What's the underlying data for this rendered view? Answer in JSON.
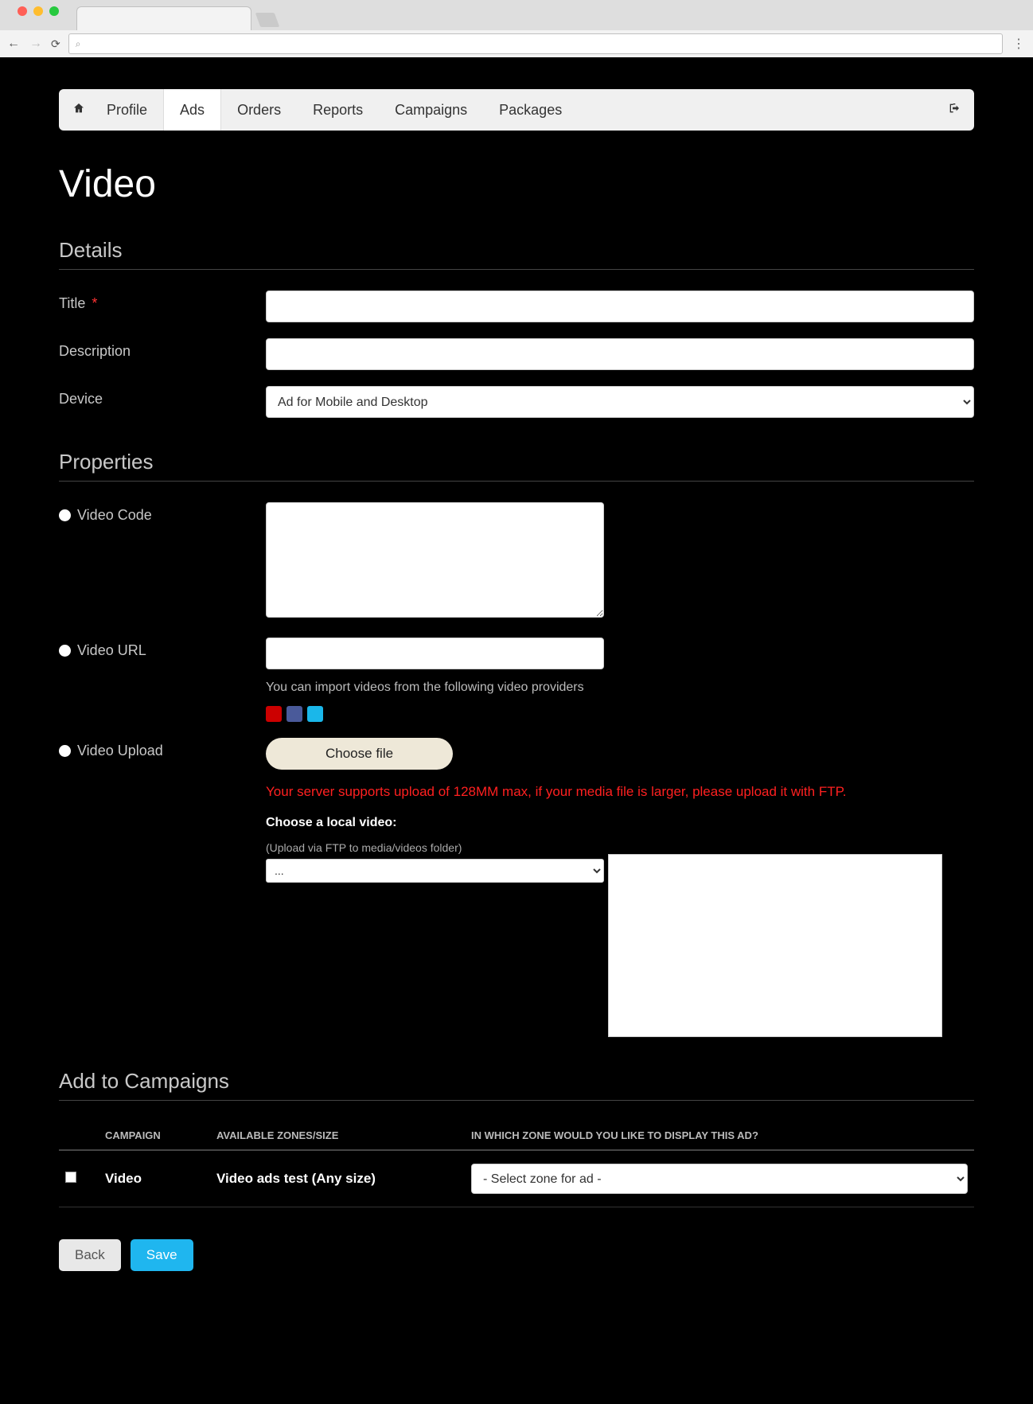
{
  "nav": {
    "items": [
      "Profile",
      "Ads",
      "Orders",
      "Reports",
      "Campaigns",
      "Packages"
    ],
    "active_index": 1
  },
  "page_title": "Video",
  "sections": {
    "details": "Details",
    "properties": "Properties",
    "campaigns": "Add to Campaigns"
  },
  "details": {
    "title_label": "Title",
    "title_value": "",
    "description_label": "Description",
    "description_value": "",
    "device_label": "Device",
    "device_selected": "Ad for Mobile and Desktop"
  },
  "properties": {
    "video_code_label": "Video Code",
    "video_code_value": "",
    "video_url_label": "Video URL",
    "video_url_value": "",
    "import_helper": "You can import videos from the following video providers",
    "video_upload_label": "Video Upload",
    "choose_file_label": "Choose file",
    "upload_warning": "Your server supports upload of 128MM max, if your media file is larger, please upload it with FTP.",
    "choose_local_label": "Choose a local video:",
    "ftp_hint": "(Upload via FTP to media/videos folder)",
    "ftp_select_placeholder": "..."
  },
  "provider_icons": [
    "youtube-icon",
    "metacafe-icon",
    "vimeo-icon"
  ],
  "campaigns_table": {
    "headers": {
      "checkbox": "",
      "campaign": "CAMPAIGN",
      "zones": "AVAILABLE ZONES/SIZE",
      "which_zone": "IN WHICH ZONE WOULD YOU LIKE TO DISPLAY THIS AD?"
    },
    "rows": [
      {
        "checked": false,
        "campaign": "Video",
        "zones": "Video ads test (Any size)",
        "zone_select": "- Select zone for ad -"
      }
    ]
  },
  "buttons": {
    "back": "Back",
    "save": "Save"
  }
}
